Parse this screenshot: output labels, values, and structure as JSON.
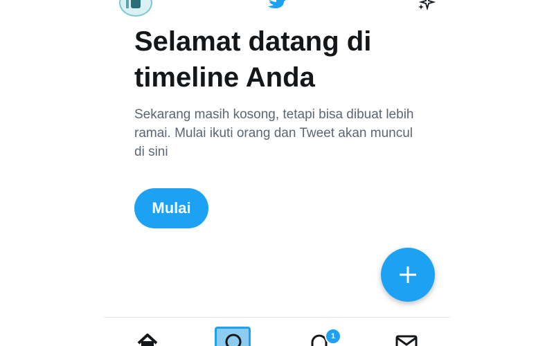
{
  "header": {
    "avatar_icon": "profile-avatar",
    "logo_icon": "twitter-bird-icon",
    "sparkle_icon": "sparkle-icon"
  },
  "main": {
    "title": "Selamat datang di timeline Anda",
    "description": "Sekarang masih kosong, tetapi bisa dibuat lebih ramai. Mulai ikuti orang dan Tweet akan muncul di sini",
    "start_button_label": "Mulai"
  },
  "fab": {
    "icon": "plus-icon"
  },
  "bottom_nav": {
    "items": [
      {
        "icon": "home-icon"
      },
      {
        "icon": "search-icon",
        "active": true
      },
      {
        "icon": "bell-icon",
        "badge": "1"
      },
      {
        "icon": "mail-icon"
      }
    ]
  },
  "colors": {
    "accent": "#1da1f2",
    "title_text": "#14171a",
    "body_text": "#5b6670",
    "divider": "#e1e8ed"
  }
}
